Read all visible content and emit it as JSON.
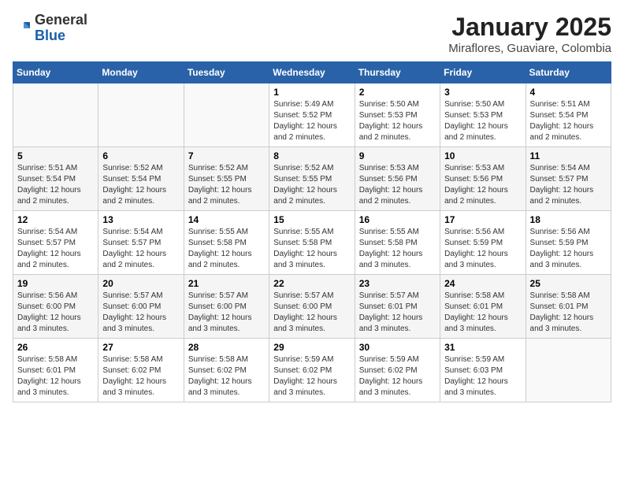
{
  "logo": {
    "general": "General",
    "blue": "Blue"
  },
  "header": {
    "month_year": "January 2025",
    "location": "Miraflores, Guaviare, Colombia"
  },
  "weekdays": [
    "Sunday",
    "Monday",
    "Tuesday",
    "Wednesday",
    "Thursday",
    "Friday",
    "Saturday"
  ],
  "weeks": [
    [
      {
        "day": "",
        "info": ""
      },
      {
        "day": "",
        "info": ""
      },
      {
        "day": "",
        "info": ""
      },
      {
        "day": "1",
        "info": "Sunrise: 5:49 AM\nSunset: 5:52 PM\nDaylight: 12 hours\nand 2 minutes."
      },
      {
        "day": "2",
        "info": "Sunrise: 5:50 AM\nSunset: 5:53 PM\nDaylight: 12 hours\nand 2 minutes."
      },
      {
        "day": "3",
        "info": "Sunrise: 5:50 AM\nSunset: 5:53 PM\nDaylight: 12 hours\nand 2 minutes."
      },
      {
        "day": "4",
        "info": "Sunrise: 5:51 AM\nSunset: 5:54 PM\nDaylight: 12 hours\nand 2 minutes."
      }
    ],
    [
      {
        "day": "5",
        "info": "Sunrise: 5:51 AM\nSunset: 5:54 PM\nDaylight: 12 hours\nand 2 minutes."
      },
      {
        "day": "6",
        "info": "Sunrise: 5:52 AM\nSunset: 5:54 PM\nDaylight: 12 hours\nand 2 minutes."
      },
      {
        "day": "7",
        "info": "Sunrise: 5:52 AM\nSunset: 5:55 PM\nDaylight: 12 hours\nand 2 minutes."
      },
      {
        "day": "8",
        "info": "Sunrise: 5:52 AM\nSunset: 5:55 PM\nDaylight: 12 hours\nand 2 minutes."
      },
      {
        "day": "9",
        "info": "Sunrise: 5:53 AM\nSunset: 5:56 PM\nDaylight: 12 hours\nand 2 minutes."
      },
      {
        "day": "10",
        "info": "Sunrise: 5:53 AM\nSunset: 5:56 PM\nDaylight: 12 hours\nand 2 minutes."
      },
      {
        "day": "11",
        "info": "Sunrise: 5:54 AM\nSunset: 5:57 PM\nDaylight: 12 hours\nand 2 minutes."
      }
    ],
    [
      {
        "day": "12",
        "info": "Sunrise: 5:54 AM\nSunset: 5:57 PM\nDaylight: 12 hours\nand 2 minutes."
      },
      {
        "day": "13",
        "info": "Sunrise: 5:54 AM\nSunset: 5:57 PM\nDaylight: 12 hours\nand 2 minutes."
      },
      {
        "day": "14",
        "info": "Sunrise: 5:55 AM\nSunset: 5:58 PM\nDaylight: 12 hours\nand 2 minutes."
      },
      {
        "day": "15",
        "info": "Sunrise: 5:55 AM\nSunset: 5:58 PM\nDaylight: 12 hours\nand 3 minutes."
      },
      {
        "day": "16",
        "info": "Sunrise: 5:55 AM\nSunset: 5:58 PM\nDaylight: 12 hours\nand 3 minutes."
      },
      {
        "day": "17",
        "info": "Sunrise: 5:56 AM\nSunset: 5:59 PM\nDaylight: 12 hours\nand 3 minutes."
      },
      {
        "day": "18",
        "info": "Sunrise: 5:56 AM\nSunset: 5:59 PM\nDaylight: 12 hours\nand 3 minutes."
      }
    ],
    [
      {
        "day": "19",
        "info": "Sunrise: 5:56 AM\nSunset: 6:00 PM\nDaylight: 12 hours\nand 3 minutes."
      },
      {
        "day": "20",
        "info": "Sunrise: 5:57 AM\nSunset: 6:00 PM\nDaylight: 12 hours\nand 3 minutes."
      },
      {
        "day": "21",
        "info": "Sunrise: 5:57 AM\nSunset: 6:00 PM\nDaylight: 12 hours\nand 3 minutes."
      },
      {
        "day": "22",
        "info": "Sunrise: 5:57 AM\nSunset: 6:00 PM\nDaylight: 12 hours\nand 3 minutes."
      },
      {
        "day": "23",
        "info": "Sunrise: 5:57 AM\nSunset: 6:01 PM\nDaylight: 12 hours\nand 3 minutes."
      },
      {
        "day": "24",
        "info": "Sunrise: 5:58 AM\nSunset: 6:01 PM\nDaylight: 12 hours\nand 3 minutes."
      },
      {
        "day": "25",
        "info": "Sunrise: 5:58 AM\nSunset: 6:01 PM\nDaylight: 12 hours\nand 3 minutes."
      }
    ],
    [
      {
        "day": "26",
        "info": "Sunrise: 5:58 AM\nSunset: 6:01 PM\nDaylight: 12 hours\nand 3 minutes."
      },
      {
        "day": "27",
        "info": "Sunrise: 5:58 AM\nSunset: 6:02 PM\nDaylight: 12 hours\nand 3 minutes."
      },
      {
        "day": "28",
        "info": "Sunrise: 5:58 AM\nSunset: 6:02 PM\nDaylight: 12 hours\nand 3 minutes."
      },
      {
        "day": "29",
        "info": "Sunrise: 5:59 AM\nSunset: 6:02 PM\nDaylight: 12 hours\nand 3 minutes."
      },
      {
        "day": "30",
        "info": "Sunrise: 5:59 AM\nSunset: 6:02 PM\nDaylight: 12 hours\nand 3 minutes."
      },
      {
        "day": "31",
        "info": "Sunrise: 5:59 AM\nSunset: 6:03 PM\nDaylight: 12 hours\nand 3 minutes."
      },
      {
        "day": "",
        "info": ""
      }
    ]
  ]
}
